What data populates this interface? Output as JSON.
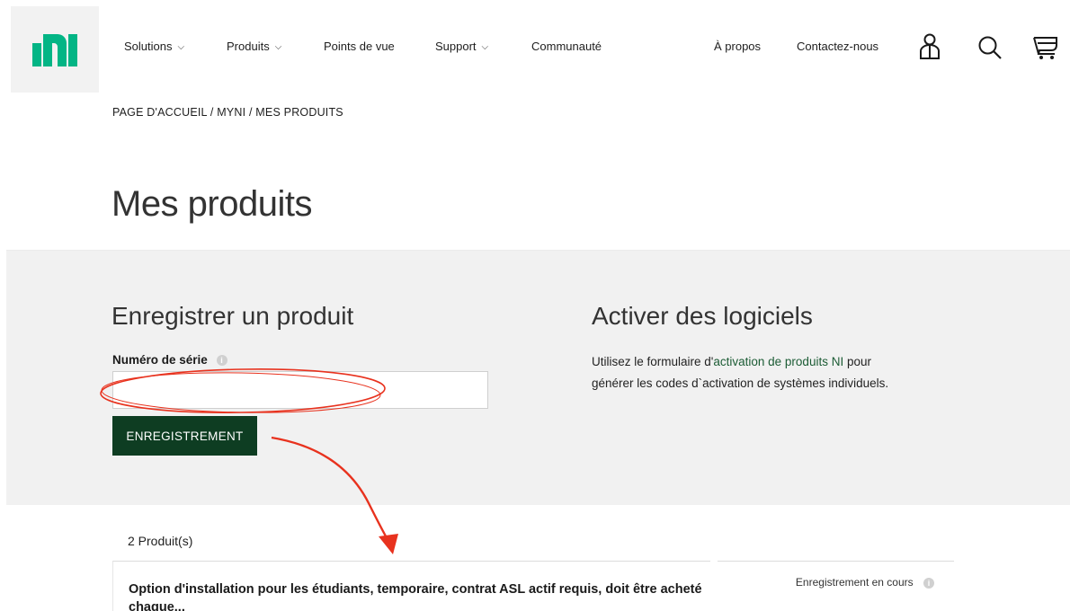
{
  "header": {
    "nav": [
      {
        "label": "Solutions",
        "dropdown": true
      },
      {
        "label": "Produits",
        "dropdown": true
      },
      {
        "label": "Points de vue",
        "dropdown": false
      },
      {
        "label": "Support",
        "dropdown": true
      },
      {
        "label": "Communauté",
        "dropdown": false
      }
    ],
    "right_links": {
      "about": "À propos",
      "contact": "Contactez-nous"
    },
    "icons": [
      "ni-logo",
      "user-icon",
      "search-icon",
      "cart-icon"
    ]
  },
  "breadcrumb": "PAGE D'ACCUEIL / MYNI / MES PRODUITS",
  "page_title": "Mes produits",
  "register": {
    "title": "Enregistrer un produit",
    "serial_label": "Numéro de série",
    "serial_value": "",
    "button_label": "ENREGISTREMENT"
  },
  "activate": {
    "title": "Activer des logiciels",
    "text_before": "Utilisez le formulaire d'",
    "link_text": "activation de produits NI",
    "text_after": " pour générer les codes d`activation de systèmes individuels."
  },
  "products": {
    "count_label": "2 Produit(s)",
    "items": [
      {
        "title": "Option d'installation pour les étudiants, temporaire, contrat ASL actif requis, doit être acheté chaque...",
        "status": "Enregistrement en cours"
      }
    ]
  },
  "colors": {
    "brand_green": "#03b585",
    "button_dark_green": "#0e3d22",
    "link_green": "#1c5c35",
    "annotation_red": "#e8321e",
    "band_gray": "#f1f1f1"
  }
}
